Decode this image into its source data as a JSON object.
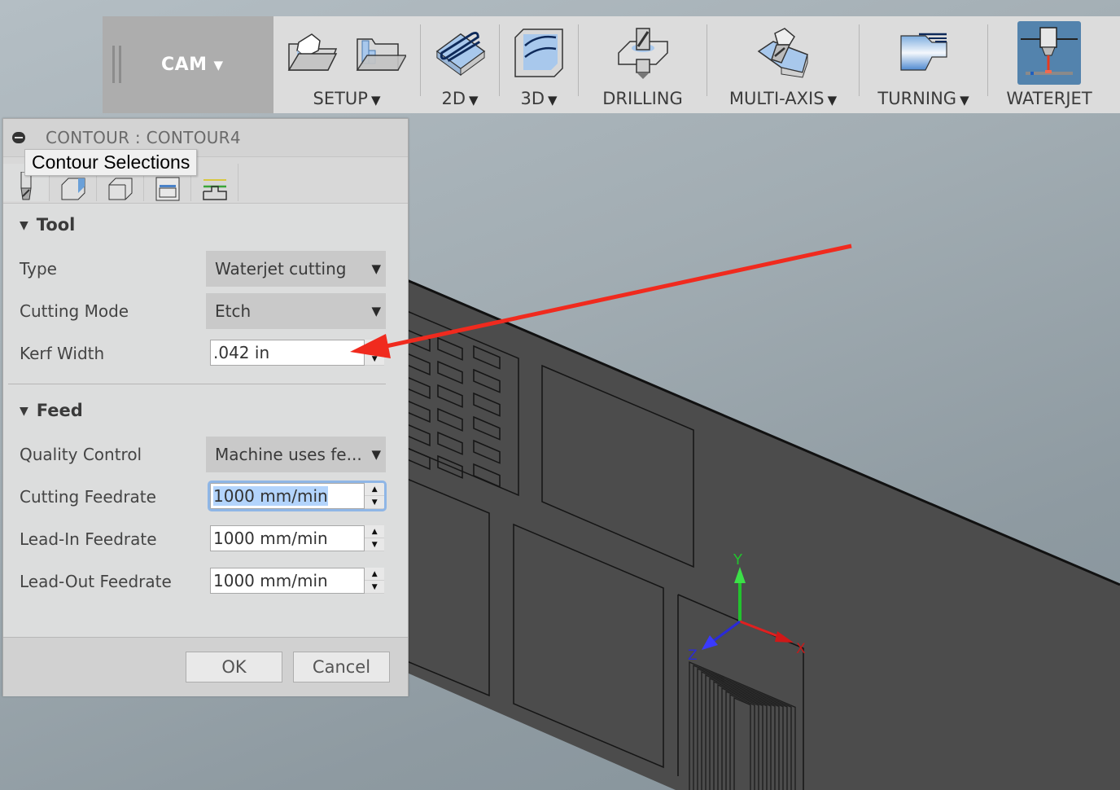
{
  "toolbar": {
    "workspace": "CAM",
    "groups": [
      {
        "label": "SETUP",
        "has_menu": true,
        "icons": [
          "setup-new-icon",
          "setup-folder-icon"
        ]
      },
      {
        "label": "2D",
        "has_menu": true,
        "icons": [
          "2d-milling-icon"
        ]
      },
      {
        "label": "3D",
        "has_menu": true,
        "icons": [
          "3d-milling-icon"
        ]
      },
      {
        "label": "DRILLING",
        "has_menu": false,
        "icons": [
          "drilling-icon"
        ]
      },
      {
        "label": "MULTI-AXIS",
        "has_menu": true,
        "icons": [
          "multi-axis-icon"
        ]
      },
      {
        "label": "TURNING",
        "has_menu": true,
        "icons": [
          "turning-icon"
        ]
      },
      {
        "label": "WATERJET",
        "has_menu": false,
        "active": true,
        "icons": [
          "waterjet-icon"
        ]
      }
    ],
    "caret": "▼"
  },
  "dialog": {
    "title": "CONTOUR : CONTOUR4",
    "tooltip": "Contour Selections",
    "tabs": [
      "tool-tab",
      "geometry-tab",
      "heights-tab",
      "passes-tab",
      "linking-tab"
    ],
    "sections": {
      "tool": {
        "heading": "Tool",
        "type": {
          "label": "Type",
          "value": "Waterjet cutting"
        },
        "cutting_mode": {
          "label": "Cutting Mode",
          "value": "Etch"
        },
        "kerf_width": {
          "label": "Kerf Width",
          "value": ".042 in"
        }
      },
      "feed": {
        "heading": "Feed",
        "quality_control": {
          "label": "Quality Control",
          "value": "Machine uses fe..."
        },
        "cutting_feedrate": {
          "label": "Cutting Feedrate",
          "value": "1000 mm/min"
        },
        "lead_in_feedrate": {
          "label": "Lead-In Feedrate",
          "value": "1000 mm/min"
        },
        "lead_out_feedrate": {
          "label": "Lead-Out Feedrate",
          "value": "1000 mm/min"
        }
      }
    },
    "ok_label": "OK",
    "cancel_label": "Cancel"
  },
  "viewport": {
    "axes": {
      "x": "X",
      "y": "Y",
      "z": "Z"
    },
    "colors": {
      "x_axis": "#e02020",
      "y_axis": "#22c22e",
      "z_axis": "#2a2ad8",
      "annotation_arrow": "#f02a1e",
      "part": "#4c4c4c"
    }
  }
}
